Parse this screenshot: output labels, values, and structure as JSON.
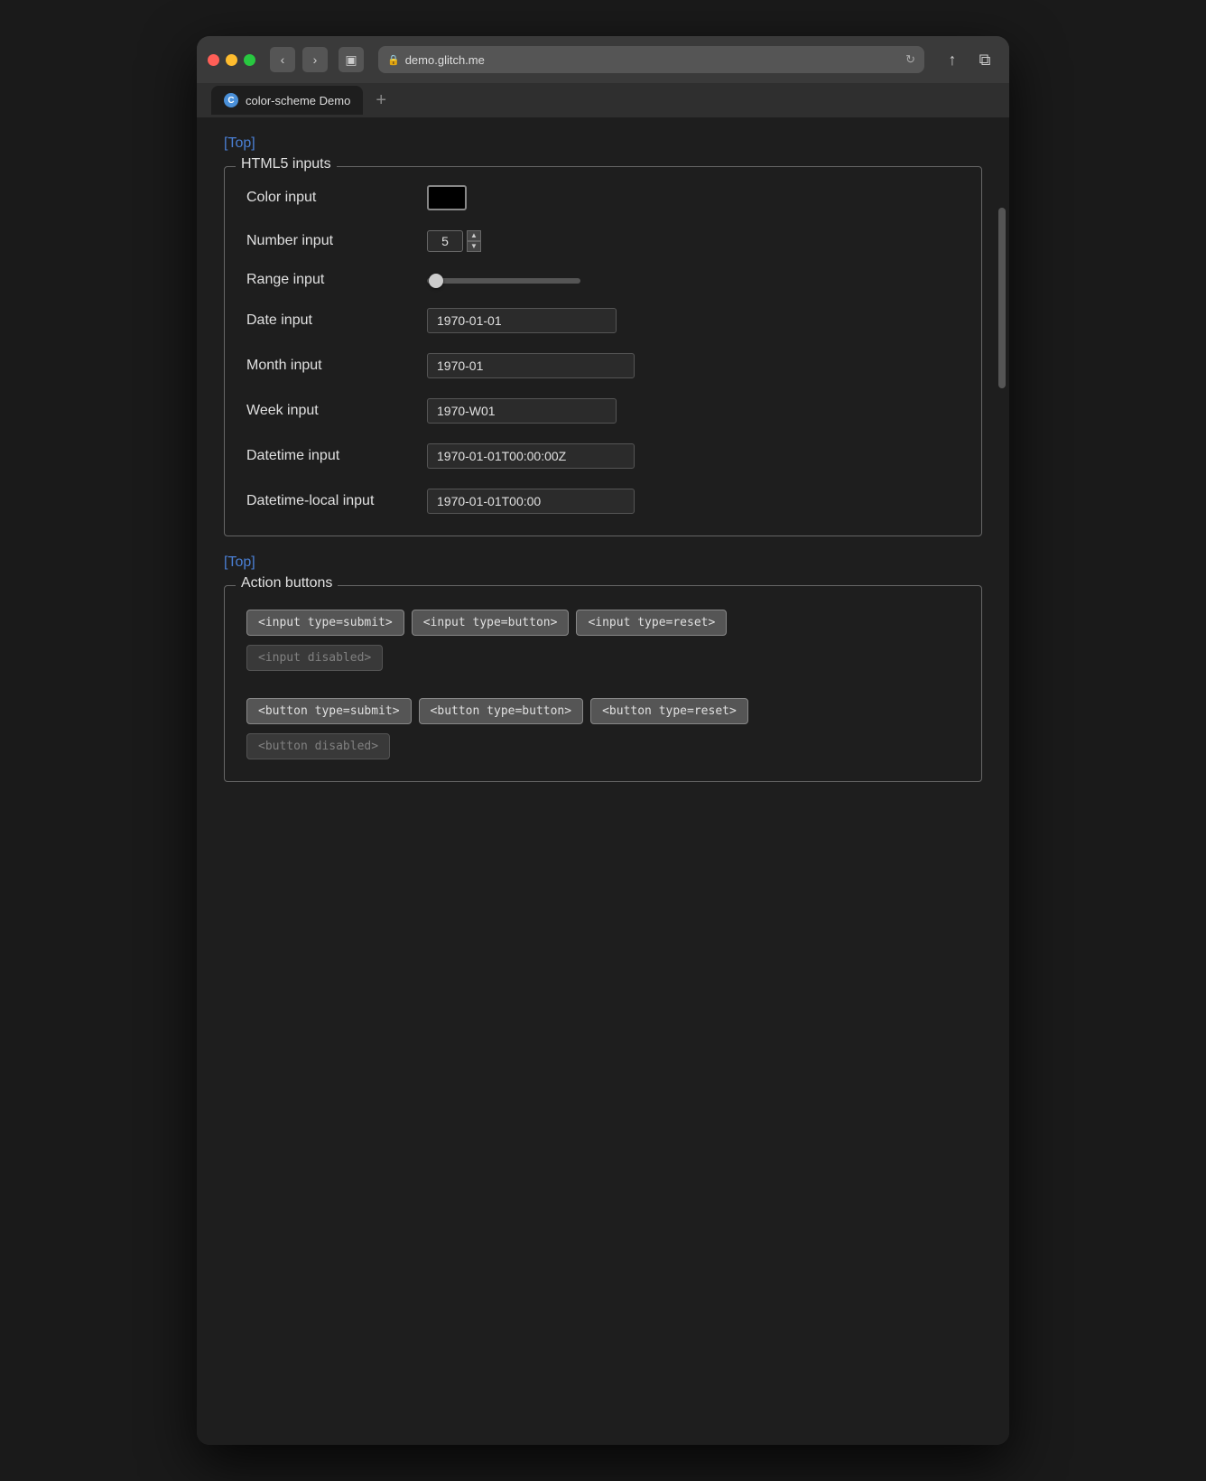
{
  "browser": {
    "url": "demo.glitch.me",
    "tab_title": "color-scheme Demo",
    "tab_favicon": "C"
  },
  "page": {
    "top_link": "[Top]",
    "html5_section": {
      "legend": "HTML5 inputs",
      "fields": [
        {
          "label": "Color input",
          "type": "color",
          "value": "#000000"
        },
        {
          "label": "Number input",
          "type": "number",
          "value": "5"
        },
        {
          "label": "Range input",
          "type": "range",
          "value": "0"
        },
        {
          "label": "Date input",
          "type": "date",
          "value": "1970-01-01"
        },
        {
          "label": "Month input",
          "type": "month",
          "value": "1970-01"
        },
        {
          "label": "Week input",
          "type": "week",
          "value": "1970-W01"
        },
        {
          "label": "Datetime input",
          "type": "datetime",
          "value": "1970-01-01T00:00:00Z"
        },
        {
          "label": "Datetime-local input",
          "type": "datetime-local",
          "value": "1970-01-01T00:00"
        }
      ]
    },
    "bottom_top_link": "[Top]",
    "action_section": {
      "legend": "Action buttons",
      "input_buttons": [
        {
          "label": "<input type=submit>"
        },
        {
          "label": "<input type=button>"
        },
        {
          "label": "<input type=reset>"
        },
        {
          "label": "<input disabled>",
          "disabled": true
        }
      ],
      "button_buttons": [
        {
          "label": "<button type=submit>"
        },
        {
          "label": "<button type=button>"
        },
        {
          "label": "<button type=reset>"
        },
        {
          "label": "<button disabled>",
          "disabled": true
        }
      ]
    }
  },
  "icons": {
    "back": "‹",
    "forward": "›",
    "sidebar": "▣",
    "menu": "≡",
    "lock": "🔒",
    "reload": "↻",
    "share": "↑",
    "newwindow": "⧉",
    "plus": "+"
  }
}
